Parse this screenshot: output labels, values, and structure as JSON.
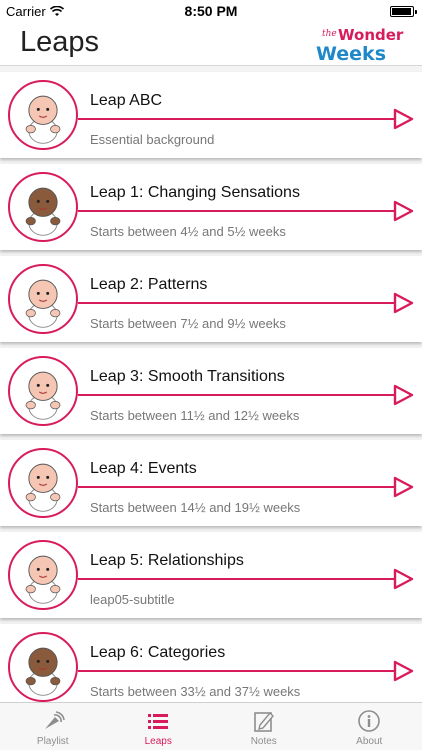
{
  "status": {
    "carrier": "Carrier",
    "time": "8:50 PM",
    "battery_level": 0.95
  },
  "header": {
    "title": "Leaps",
    "logo": {
      "line1": "the",
      "line2": "Wonder",
      "line3": "Weeks"
    }
  },
  "leaps": [
    {
      "title": "Leap ABC",
      "subtitle": "Essential background",
      "skin": "light"
    },
    {
      "title": "Leap 1: Changing Sensations",
      "subtitle": "Starts between 4½ and 5½ weeks",
      "skin": "dark"
    },
    {
      "title": "Leap 2: Patterns",
      "subtitle": "Starts between 7½ and 9½ weeks",
      "skin": "light"
    },
    {
      "title": "Leap 3: Smooth Transitions",
      "subtitle": "Starts between 11½ and 12½ weeks",
      "skin": "light"
    },
    {
      "title": "Leap 4: Events",
      "subtitle": "Starts between 14½ and 19½ weeks",
      "skin": "light"
    },
    {
      "title": "Leap 5: Relationships",
      "subtitle": "leap05-subtitle",
      "skin": "light"
    },
    {
      "title": "Leap 6: Categories",
      "subtitle": "Starts between 33½ and 37½ weeks",
      "skin": "dark"
    }
  ],
  "tabs": [
    {
      "label": "Playlist",
      "icon": "playlist-icon",
      "active": false
    },
    {
      "label": "Leaps",
      "icon": "list-icon",
      "active": true
    },
    {
      "label": "Notes",
      "icon": "notes-icon",
      "active": false
    },
    {
      "label": "About",
      "icon": "info-icon",
      "active": false
    }
  ],
  "colors": {
    "accent": "#d81b5a",
    "skin_light": "#f5c6b3",
    "skin_dark": "#8a5a3c"
  }
}
